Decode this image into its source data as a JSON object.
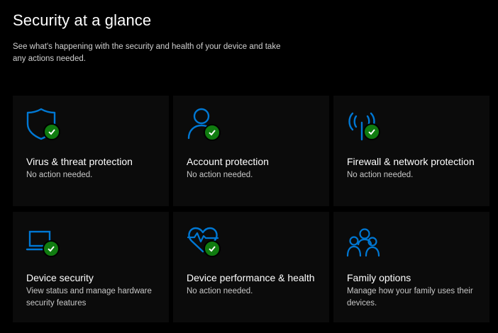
{
  "header": {
    "title": "Security at a glance",
    "subtitle": "See what's happening with the security and health of your device and take any actions needed."
  },
  "colors": {
    "accent": "#0078d4",
    "ok": "#107c10",
    "background": "#000000",
    "tile": "#0b0b0b"
  },
  "tiles": [
    {
      "title": "Virus & threat protection",
      "status": "No action needed.",
      "icon": "shield-icon",
      "ok": true
    },
    {
      "title": "Account protection",
      "status": "No action needed.",
      "icon": "person-icon",
      "ok": true
    },
    {
      "title": "Firewall & network protection",
      "status": "No action needed.",
      "icon": "antenna-icon",
      "ok": true
    },
    {
      "title": "Device security",
      "status": "View status and manage hardware security features",
      "icon": "laptop-icon",
      "ok": true
    },
    {
      "title": "Device performance & health",
      "status": "No action needed.",
      "icon": "heart-pulse-icon",
      "ok": true
    },
    {
      "title": "Family options",
      "status": "Manage how your family uses their devices.",
      "icon": "family-icon",
      "ok": false
    }
  ]
}
